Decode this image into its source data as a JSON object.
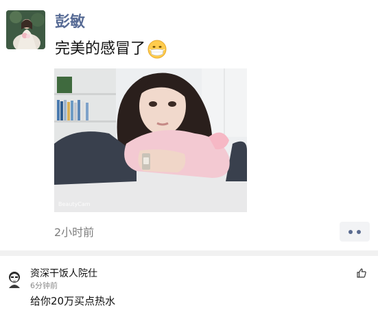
{
  "post": {
    "author": "彭敏",
    "text": "完美的感冒了",
    "emoji_icon": "mask-face-emoji-icon",
    "photo_watermark": "BeautyCam",
    "time": "2小时前"
  },
  "comment": {
    "author": "资深干饭人院仕",
    "time": "6分钟前",
    "text": "给你20万买点热水"
  },
  "colors": {
    "author_name": "#576b95",
    "divider": "#f1f1f1",
    "more_button_bg": "#f2f3f5"
  }
}
